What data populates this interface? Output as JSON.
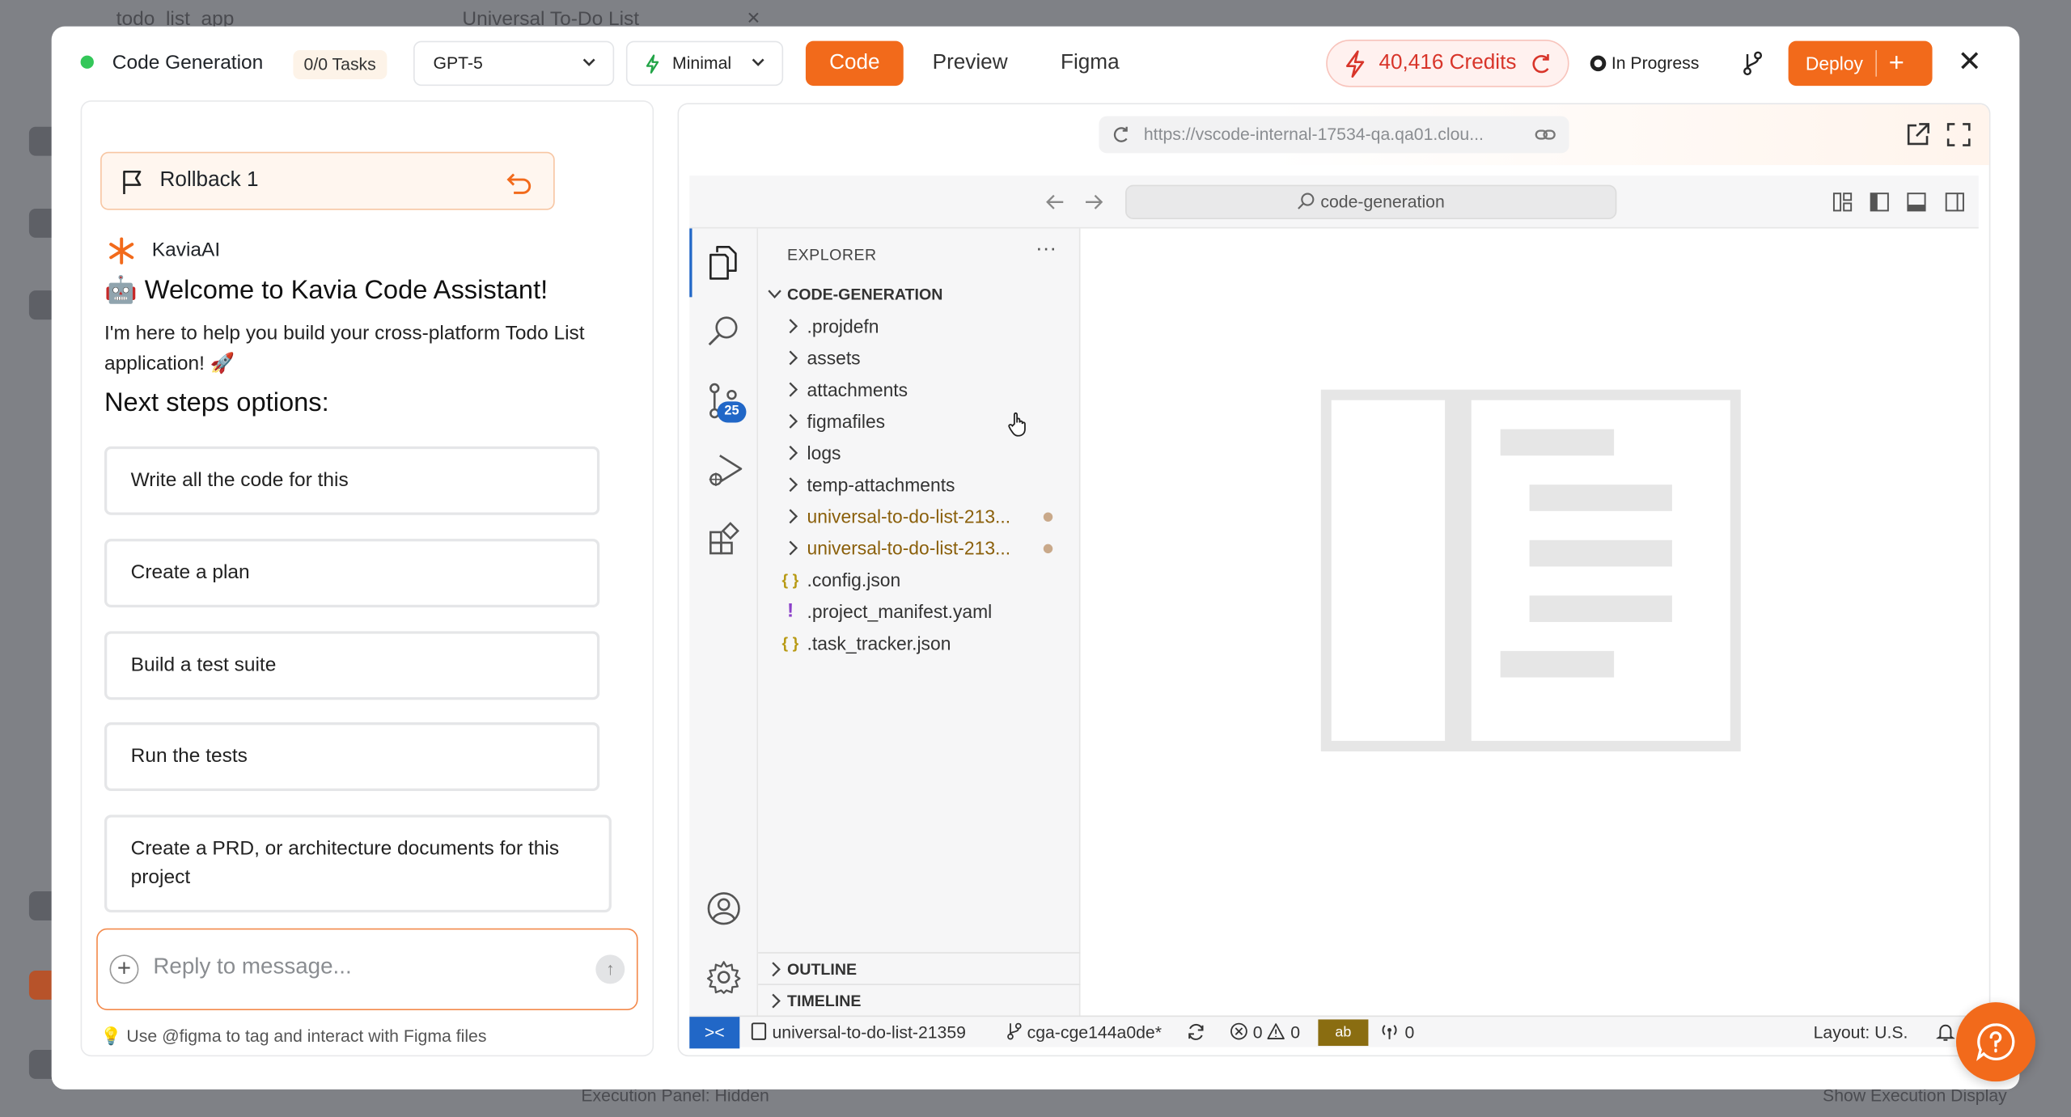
{
  "background": {
    "tab_app": "todo_list_app",
    "tab_project": "Universal To-Do List",
    "bottom_left": "Execution Panel: Hidden",
    "bottom_right": "Show Execution Display"
  },
  "header": {
    "title": "Code Generation",
    "tasks_badge": "0/0 Tasks",
    "model_select": "GPT-5",
    "mode_select": "Minimal",
    "tabs": [
      {
        "label": "Code",
        "active": true
      },
      {
        "label": "Preview",
        "active": false
      },
      {
        "label": "Figma",
        "active": false
      }
    ],
    "credits": "40,416 Credits",
    "status": "In Progress",
    "deploy_label": "Deploy",
    "deploy_plus": "+",
    "close_label": "✕"
  },
  "chat": {
    "rollback_label": "Rollback 1",
    "assistant_name": "KaviaAI",
    "welcome_emoji": "🤖",
    "welcome_title": "Welcome to Kavia Code Assistant!",
    "intro_text": "I'm here to help you build your cross-platform Todo List application! 🚀",
    "next_steps_title": "Next steps options:",
    "options": [
      "Write all the code for this",
      "Create a plan",
      "Build a test suite",
      "Run the tests",
      "Create a PRD, or architecture documents for this project"
    ],
    "reply_placeholder": "Reply to message...",
    "hint_icon": "💡",
    "hint_text": "Use @figma to tag and interact with Figma files"
  },
  "browser": {
    "url": "https://vscode-internal-17534-qa.qa01.clou..."
  },
  "vscode": {
    "search_text": "code-generation",
    "explorer_title": "EXPLORER",
    "explorer_more": "···",
    "root_folder": "CODE-GENERATION",
    "scm_badge": "25",
    "folders": [
      {
        "name": ".projdefn",
        "modified": false
      },
      {
        "name": "assets",
        "modified": false
      },
      {
        "name": "attachments",
        "modified": false
      },
      {
        "name": "figmafiles",
        "modified": false
      },
      {
        "name": "logs",
        "modified": false
      },
      {
        "name": "temp-attachments",
        "modified": false
      },
      {
        "name": "universal-to-do-list-213...",
        "modified": true
      },
      {
        "name": "universal-to-do-list-213...",
        "modified": true
      }
    ],
    "files": [
      {
        "name": ".config.json",
        "icon": "{ }"
      },
      {
        "name": ".project_manifest.yaml",
        "icon": "!"
      },
      {
        "name": ".task_tracker.json",
        "icon": "{ }"
      }
    ],
    "outline_label": "OUTLINE",
    "timeline_label": "TIMELINE",
    "status": {
      "remote_icon": "><",
      "repo": "universal-to-do-list-21359",
      "branch": "cga-cge144a0de*",
      "errors": "0",
      "warnings": "0",
      "ab_label": "ab",
      "ports": "0",
      "layout": "Layout: U.S."
    }
  },
  "colors": {
    "accent": "#f26a1b",
    "credits_red": "#d8352a",
    "status_green": "#34c759",
    "vscode_blue": "#2167c7"
  }
}
